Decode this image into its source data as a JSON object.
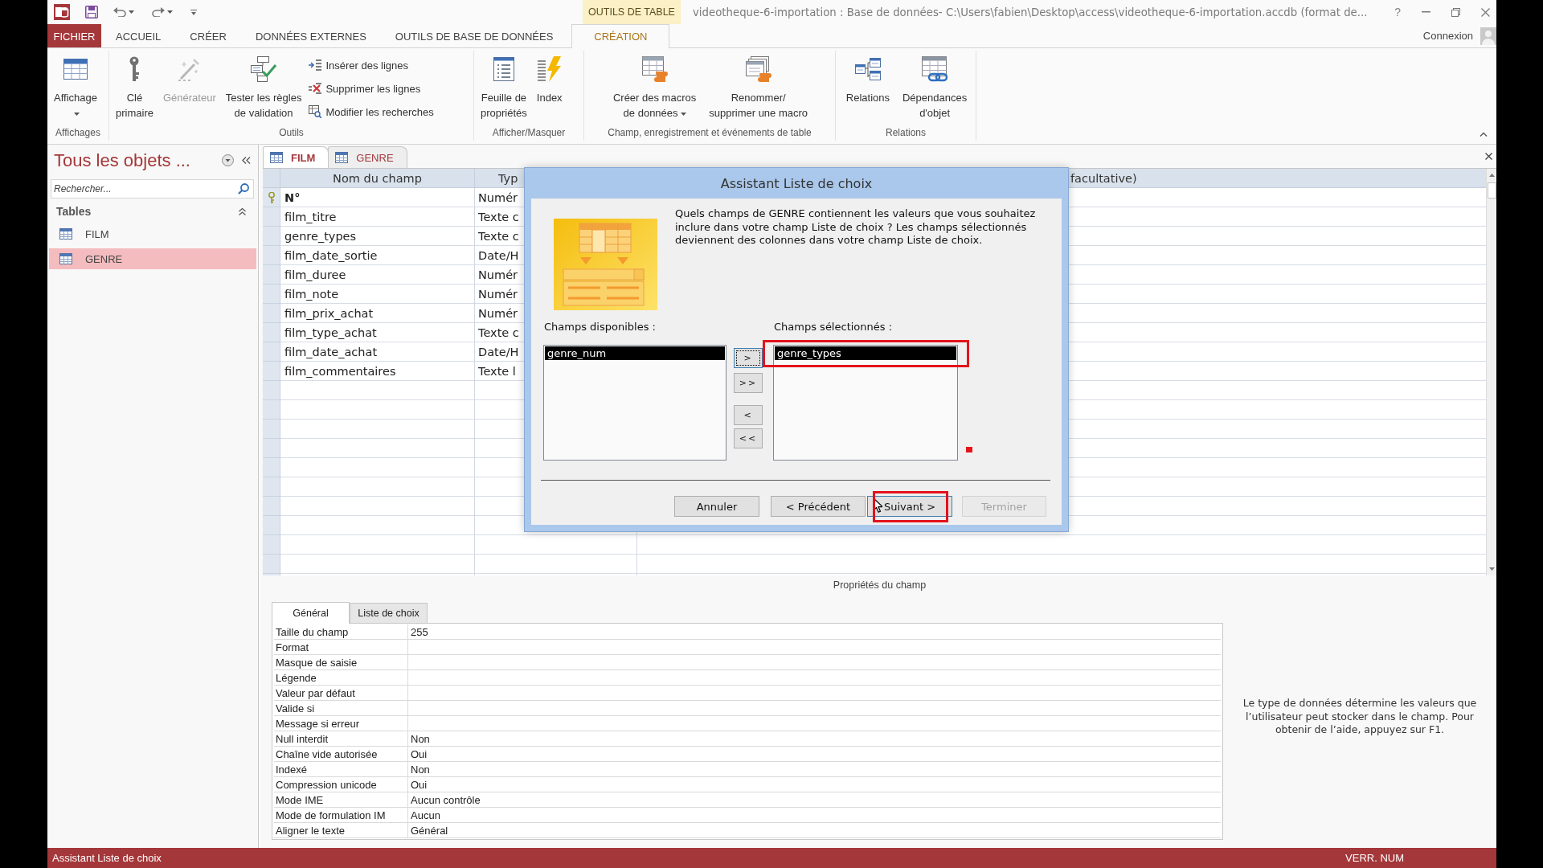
{
  "title_bar": {
    "context_label": "OUTILS DE TABLE",
    "title": "videotheque-6-importation : Base de données- C:\\Users\\fabien\\Desktop\\access\\videotheque-6-importation.accdb (format de...",
    "help": "?"
  },
  "ribbon_tabs": [
    {
      "label": "FICHIER",
      "kind": "file",
      "selected": false
    },
    {
      "label": "ACCUEIL",
      "kind": "standard",
      "selected": false
    },
    {
      "label": "CRÉER",
      "kind": "standard",
      "selected": false
    },
    {
      "label": "DONNÉES EXTERNES",
      "kind": "standard",
      "selected": false
    },
    {
      "label": "OUTILS DE BASE DE DONNÉES",
      "kind": "standard",
      "selected": false
    },
    {
      "label": "CRÉATION",
      "kind": "contextual",
      "selected": true
    }
  ],
  "account": {
    "label": "Connexion"
  },
  "ribbon_groups": [
    {
      "label": "Affichages",
      "buttons": [
        {
          "label": "Affichage",
          "kind": "large",
          "disabled": false,
          "dropdown": true
        }
      ]
    },
    {
      "label": "Outils",
      "buttons": [
        {
          "label": "Clé\nprimaire",
          "kind": "large",
          "disabled": false,
          "dropdown": false
        },
        {
          "label": "Générateur",
          "kind": "large",
          "disabled": true,
          "dropdown": false
        },
        {
          "label": "Tester les règles\nde validation",
          "kind": "large",
          "disabled": false,
          "dropdown": false
        },
        {
          "label": "Insérer des lignes",
          "kind": "small",
          "disabled": false,
          "dropdown": false
        },
        {
          "label": "Supprimer les lignes",
          "kind": "small",
          "disabled": false,
          "dropdown": false
        },
        {
          "label": "Modifier les recherches",
          "kind": "small",
          "disabled": false,
          "dropdown": false
        }
      ]
    },
    {
      "label": "Afficher/Masquer",
      "buttons": [
        {
          "label": "Feuille de\npropriétés",
          "kind": "large",
          "disabled": false,
          "dropdown": false
        },
        {
          "label": "Index",
          "kind": "large",
          "disabled": false,
          "dropdown": false
        }
      ]
    },
    {
      "label": "Champ, enregistrement et événements de table",
      "buttons": [
        {
          "label": "Créer des macros\nde données",
          "kind": "large",
          "disabled": false,
          "dropdown": true
        },
        {
          "label": "Renommer/\nsupprimer une macro",
          "kind": "large",
          "disabled": false,
          "dropdown": false
        }
      ]
    },
    {
      "label": "Relations",
      "buttons": [
        {
          "label": "Relations",
          "kind": "large",
          "disabled": false,
          "dropdown": false
        },
        {
          "label": "Dépendances\nd'objet",
          "kind": "large",
          "disabled": false,
          "dropdown": false
        }
      ]
    }
  ],
  "navigation_pane": {
    "title": "Tous les objets ...",
    "search": {
      "placeholder": "Rechercher..."
    },
    "groups": [
      {
        "label": "Tables",
        "expanded": true,
        "items": [
          {
            "label": "FILM",
            "selected": false
          },
          {
            "label": "GENRE",
            "selected": true
          }
        ]
      }
    ]
  },
  "document_tabs": [
    {
      "label": "FILM",
      "selected": true
    },
    {
      "label": "GENRE",
      "selected": false
    }
  ],
  "design_grid": {
    "columns": [
      {
        "label": "Nom du champ"
      },
      {
        "label": "Typ"
      },
      {
        "label": "facultative)"
      }
    ],
    "rows": [
      {
        "name": "N°",
        "type": "Numér",
        "primary_key": true
      },
      {
        "name": "film_titre",
        "type": "Texte c",
        "primary_key": false
      },
      {
        "name": "genre_types",
        "type": "Texte c",
        "primary_key": false
      },
      {
        "name": "film_date_sortie",
        "type": "Date/H",
        "primary_key": false
      },
      {
        "name": "film_duree",
        "type": "Numér",
        "primary_key": false
      },
      {
        "name": "film_note",
        "type": "Numér",
        "primary_key": false
      },
      {
        "name": "film_prix_achat",
        "type": "Numér",
        "primary_key": false
      },
      {
        "name": "film_type_achat",
        "type": "Texte c",
        "primary_key": false
      },
      {
        "name": "film_date_achat",
        "type": "Date/H",
        "primary_key": false
      },
      {
        "name": "film_commentaires",
        "type": "Texte l",
        "primary_key": false
      }
    ]
  },
  "dialog": {
    "title": "Assistant Liste de choix",
    "message": "Quels champs de GENRE contiennent les valeurs que vous souhaitez inclure dans votre champ Liste de choix ? Les champs sélectionnés deviennent des colonnes dans votre champ Liste de choix.",
    "available_fields": {
      "label": "Champs disponibles :",
      "items": [
        {
          "label": "genre_num",
          "selected": true
        }
      ]
    },
    "selected_fields": {
      "label": "Champs sélectionnés :",
      "items": [
        {
          "label": "genre_types",
          "selected": true
        }
      ]
    },
    "move_buttons": [
      {
        "label": ">",
        "focused": true
      },
      {
        "label": ">>",
        "focused": false
      },
      {
        "label": "<",
        "focused": false
      },
      {
        "label": "<<",
        "focused": false
      }
    ],
    "buttons": [
      {
        "label": "Annuler",
        "default": false,
        "disabled": false
      },
      {
        "label": "< Précédent",
        "default": false,
        "disabled": false
      },
      {
        "label": "Suivant >",
        "default": true,
        "disabled": false
      },
      {
        "label": "Terminer",
        "default": false,
        "disabled": true
      }
    ],
    "annotations": [
      {
        "kind": "frame"
      },
      {
        "kind": "dot"
      },
      {
        "kind": "frame"
      }
    ]
  },
  "field_properties": {
    "title": "Propriétés du champ",
    "tabs": [
      {
        "label": "Général",
        "selected": true
      },
      {
        "label": "Liste de choix",
        "selected": false
      }
    ],
    "rows": [
      {
        "label": "Taille du champ",
        "value": "255"
      },
      {
        "label": "Format"
      },
      {
        "label": "Masque de saisie"
      },
      {
        "label": "Légende"
      },
      {
        "label": "Valeur par défaut"
      },
      {
        "label": "Valide si"
      },
      {
        "label": "Message si erreur"
      },
      {
        "label": "Null interdit",
        "value": "Non"
      },
      {
        "label": "Chaîne vide autorisée",
        "value": "Oui"
      },
      {
        "label": "Indexé",
        "value": "Non"
      },
      {
        "label": "Compression unicode",
        "value": "Oui"
      },
      {
        "label": "Mode IME",
        "value": "Aucun contrôle"
      },
      {
        "label": "Mode de formulation IM",
        "value": "Aucun"
      },
      {
        "label": "Aligner le texte",
        "value": "Général"
      }
    ],
    "help": "Le type de données détermine les valeurs que l’utilisateur peut stocker dans le champ. Pour obtenir de l’aide, appuyez sur F1."
  },
  "status_bar": {
    "message": "Assistant Liste de choix",
    "indicator": "VERR. NUM"
  }
}
